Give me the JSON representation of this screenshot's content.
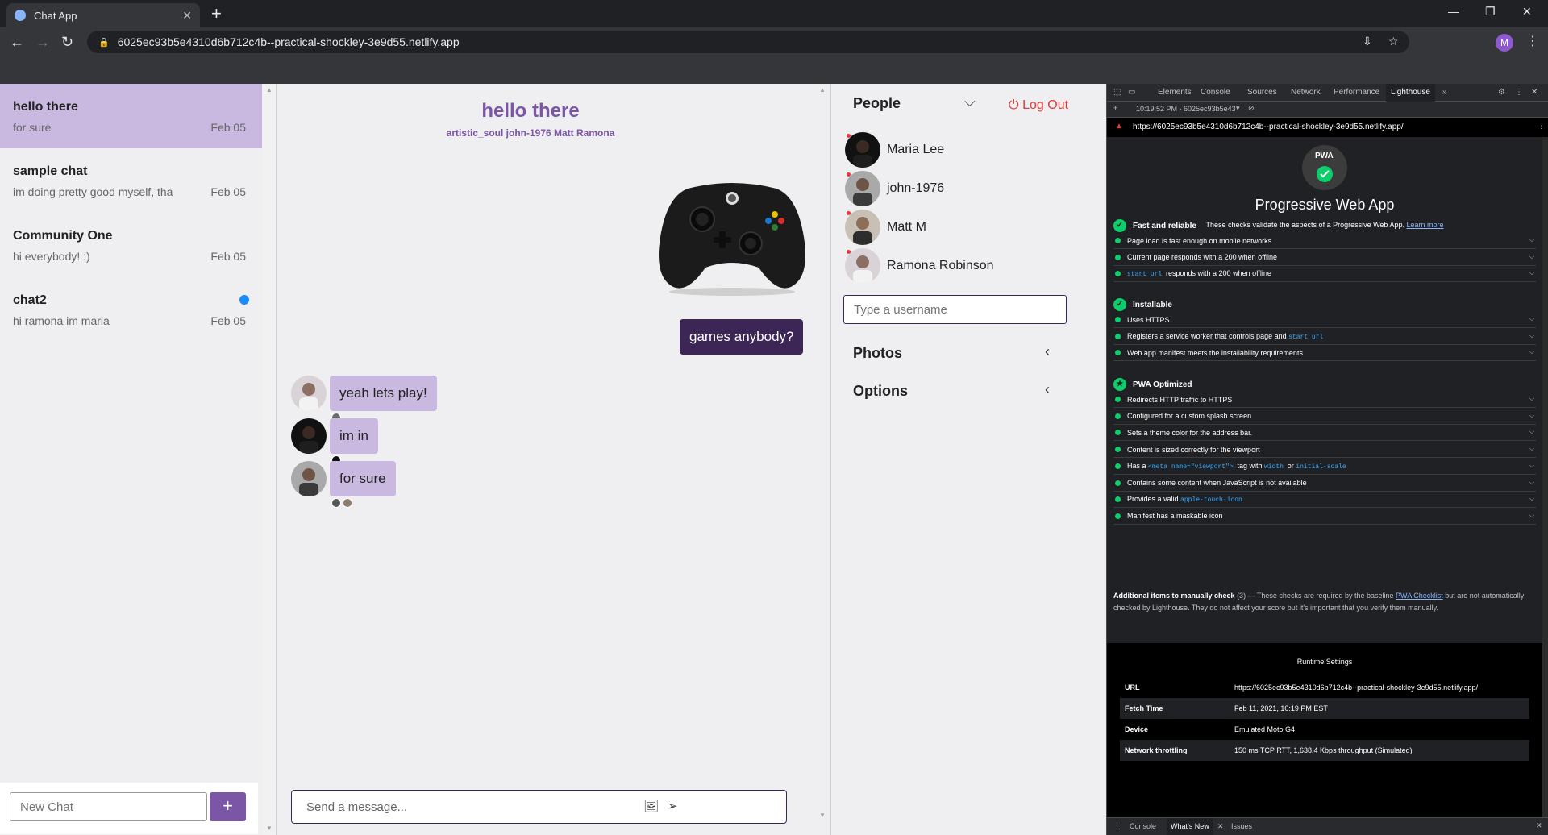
{
  "browser": {
    "tab_title": "Chat App",
    "url": "6025ec93b5e4310d6b712c4b--practical-shockley-3e9d55.netlify.app",
    "profile_initial": "M"
  },
  "chats": [
    {
      "title": "hello there",
      "preview": "for sure",
      "date": "Feb 05",
      "active": true,
      "unread": false
    },
    {
      "title": "sample chat",
      "preview": "im doing pretty good myself, tha",
      "date": "Feb 05",
      "active": false,
      "unread": false
    },
    {
      "title": "Community One",
      "preview": "hi everybody! :)",
      "date": "Feb 05",
      "active": false,
      "unread": false
    },
    {
      "title": "chat2",
      "preview": "hi ramona im maria",
      "date": "Feb 05",
      "active": false,
      "unread": true
    }
  ],
  "new_chat": {
    "placeholder": "New Chat",
    "button": "+"
  },
  "feed": {
    "title": "hello there",
    "members": "artistic_soul john-1976 Matt Ramona",
    "my_message": "games anybody?",
    "messages": [
      {
        "text": "yeah lets play!"
      },
      {
        "text": "im in"
      },
      {
        "text": "for sure"
      }
    ],
    "input_placeholder": "Send a message..."
  },
  "people_panel": {
    "heading": "People",
    "logout": "Log Out",
    "people": [
      "Maria Lee",
      "john-1976",
      "Matt M",
      "Ramona Robinson"
    ],
    "username_placeholder": "Type a username",
    "photos": "Photos",
    "options": "Options"
  },
  "devtools": {
    "tabs": [
      "Elements",
      "Console",
      "Sources",
      "Network",
      "Performance",
      "Lighthouse"
    ],
    "report_time": "10:19:52 PM - 6025ec93b5e43",
    "report_url": "https://6025ec93b5e4310d6b712c4b--practical-shockley-3e9d55.netlify.app/",
    "badge_text": "PWA",
    "title": "Progressive Web App",
    "description": "These checks validate the aspects of a Progressive Web App.",
    "learn_more": "Learn more",
    "groups": [
      {
        "name": "Fast and reliable",
        "items": [
          "Page load is fast enough on mobile networks",
          "Current page responds with a 200 when offline",
          "start_url| responds with a 200 when offline"
        ]
      },
      {
        "name": "Installable",
        "items": [
          "Uses HTTPS",
          "Registers a service worker that controls page and |start_url",
          "Web app manifest meets the installability requirements"
        ]
      },
      {
        "name": "PWA Optimized",
        "items": [
          "Redirects HTTP traffic to HTTPS",
          "Configured for a custom splash screen",
          "Sets a theme color for the address bar.",
          "Content is sized correctly for the viewport",
          "Has a |<meta name=\"viewport\">| tag with |width| or |initial-scale",
          "Contains some content when JavaScript is not available",
          "Provides a valid |apple-touch-icon",
          "Manifest has a maskable icon"
        ]
      }
    ],
    "manual_heading": "Additional items to manually check",
    "manual_count": "(3)",
    "manual_text_1": "— These checks are required by the baseline",
    "manual_link": "PWA Checklist",
    "manual_text_2": "but are not automatically checked by Lighthouse. They do not affect your score but it's important that you verify them manually.",
    "runtime_title": "Runtime Settings",
    "runtime": [
      {
        "key": "URL",
        "value": "https://6025ec93b5e4310d6b712c4b--practical-shockley-3e9d55.netlify.app/"
      },
      {
        "key": "Fetch Time",
        "value": "Feb 11, 2021, 10:19 PM EST"
      },
      {
        "key": "Device",
        "value": "Emulated Moto G4"
      },
      {
        "key": "Network throttling",
        "value": "150 ms TCP RTT, 1,638.4 Kbps throughput (Simulated)"
      }
    ],
    "drawer_tabs": [
      "Console",
      "What's New",
      "Issues"
    ]
  },
  "colors": {
    "accent": "#7b55a6",
    "dark_bubble": "#3b2655",
    "light_bubble": "#c9b8e0",
    "pass": "#0cce6b"
  }
}
